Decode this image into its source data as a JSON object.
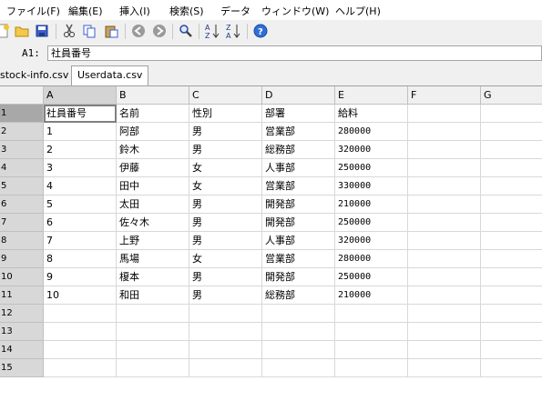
{
  "menu": [
    "ファイル(F)",
    "編集(E)",
    "挿入(I)",
    "検索(S)",
    "データ",
    "ウィンドウ(W)",
    "ヘルプ(H)"
  ],
  "formula_bar": {
    "cell_ref": "A1:",
    "value": "社員番号"
  },
  "tabs": [
    "stock-info.csv",
    "Userdata.csv"
  ],
  "active_tab": "Userdata.csv",
  "columns": [
    "A",
    "B",
    "C",
    "D",
    "E",
    "F",
    "G"
  ],
  "rows": [
    "1",
    "2",
    "3",
    "4",
    "5",
    "6",
    "7",
    "8",
    "9",
    "10",
    "11",
    "12",
    "13",
    "14",
    "15"
  ],
  "sheet": [
    [
      "社員番号",
      "名前",
      "性別",
      "部署",
      "給料"
    ],
    [
      "1",
      "阿部",
      "男",
      "営業部",
      "280000"
    ],
    [
      "2",
      "鈴木",
      "男",
      "総務部",
      "320000"
    ],
    [
      "3",
      "伊藤",
      "女",
      "人事部",
      "250000"
    ],
    [
      "4",
      "田中",
      "女",
      "営業部",
      "330000"
    ],
    [
      "5",
      "太田",
      "男",
      "開発部",
      "210000"
    ],
    [
      "6",
      "佐々木",
      "男",
      "開発部",
      "250000"
    ],
    [
      "7",
      "上野",
      "男",
      "人事部",
      "320000"
    ],
    [
      "8",
      "馬場",
      "女",
      "営業部",
      "280000"
    ],
    [
      "9",
      "榎本",
      "男",
      "開発部",
      "250000"
    ],
    [
      "10",
      "和田",
      "男",
      "総務部",
      "210000"
    ]
  ],
  "selected_cell": "A1",
  "icons": [
    "new-file-icon",
    "open-folder-icon",
    "save-icon",
    "cut-icon",
    "copy-icon",
    "paste-icon",
    "undo-icon",
    "redo-icon",
    "search-icon",
    "sort-ascending-icon",
    "sort-descending-icon",
    "help-icon"
  ]
}
